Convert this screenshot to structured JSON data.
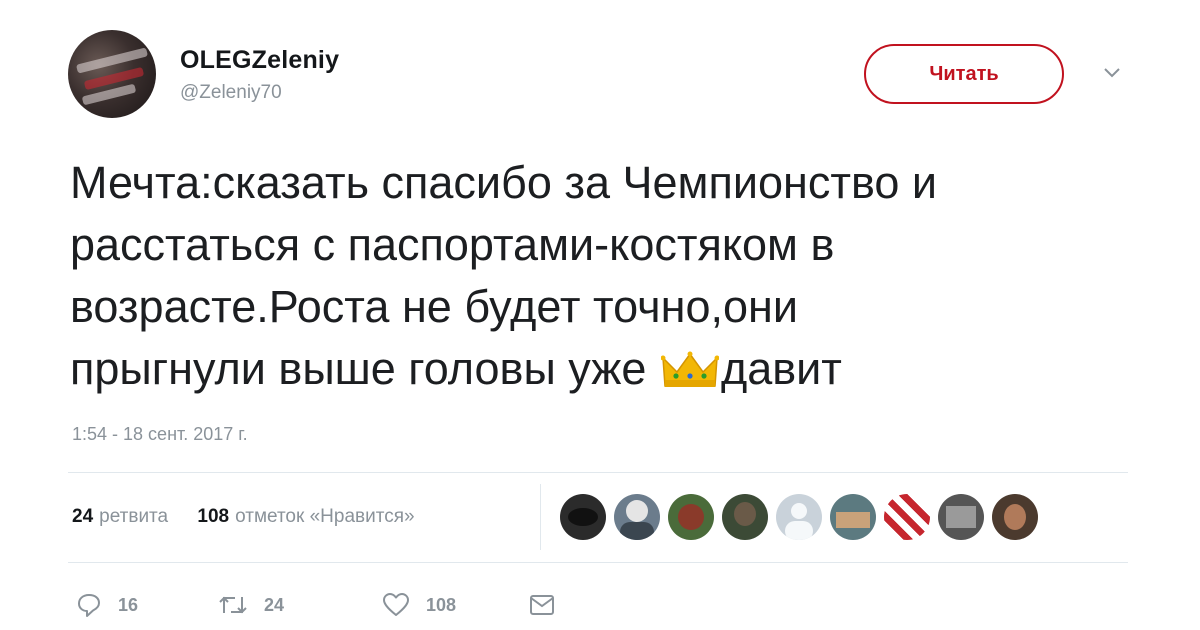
{
  "user": {
    "display_name": "OLEGZeleniy",
    "handle": "@Zeleniy70"
  },
  "follow_button": {
    "label": "Читать"
  },
  "tweet": {
    "text": "Мечта:сказать спасибо за Чемпионство и\nрасстаться с паспортами-костяком в\nвозрасте.Роста не будет точно,они\nпрыгнули выше головы уже ",
    "text_after_emoji": "давит",
    "emoji": "crown-emoji",
    "timestamp": "1:54 - 18 сент. 2017 г."
  },
  "stats": {
    "retweets_count": "24",
    "retweets_label": "ретвита",
    "likes_count": "108",
    "likes_label": "отметок «Нравится»"
  },
  "likers": [
    {
      "icon": "liker-avatar-1",
      "color": "#2b2b2b"
    },
    {
      "icon": "liker-avatar-2",
      "color": "#6b7c8c"
    },
    {
      "icon": "liker-avatar-3",
      "color": "#4a6b3a"
    },
    {
      "icon": "liker-avatar-4",
      "color": "#3c4a36"
    },
    {
      "icon": "liker-avatar-5",
      "color": "#c9d2da"
    },
    {
      "icon": "liker-avatar-6",
      "color": "#5c7a80"
    },
    {
      "icon": "liker-avatar-7",
      "color": "#c6262e"
    },
    {
      "icon": "liker-avatar-8",
      "color": "#555555"
    },
    {
      "icon": "liker-avatar-9",
      "color": "#4b3a2e"
    }
  ],
  "actions": {
    "reply_count": "16",
    "retweet_count": "24",
    "like_count": "108"
  },
  "colors": {
    "accent": "#c1121f",
    "muted": "#8a9299",
    "divider": "#e1e8ed"
  }
}
